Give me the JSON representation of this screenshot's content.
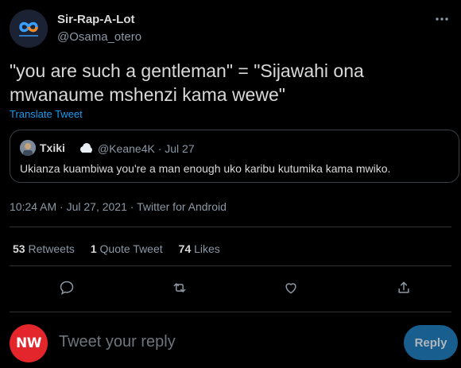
{
  "author": {
    "name": "Sir-Rap-A-Lot",
    "handle": "@Osama_otero",
    "avatar_icon": "infinity-logo-icon"
  },
  "tweet": {
    "text": "\"you are such a gentleman\" = \"Sijawahi ona mwanaume mshenzi kama wewe\"",
    "translate_label": "Translate Tweet"
  },
  "quoted_tweet": {
    "name": "Txiki",
    "emoji_icon": "cloud-icon",
    "meta": "@Keane4K · Jul 27",
    "text": "Ukianza kuambiwa you're a man enough uko karibu kutumika kama mwiko."
  },
  "timestamp": "10:24 AM · Jul 27, 2021 · Twitter for Android",
  "stats": {
    "retweets_count": "53",
    "retweets_label": "Retweets",
    "quotes_count": "1",
    "quotes_label": "Quote Tweet",
    "likes_count": "74",
    "likes_label": "Likes"
  },
  "actions": [
    "reply-icon",
    "retweet-icon",
    "like-icon",
    "share-icon"
  ],
  "reply_box": {
    "avatar_text": "NW",
    "placeholder": "Tweet your reply",
    "button_label": "Reply"
  },
  "colors": {
    "background": "#000000",
    "accent": "#1d9bf0",
    "reply_button": "#1d6fa8",
    "reply_avatar": "#e3262c"
  }
}
